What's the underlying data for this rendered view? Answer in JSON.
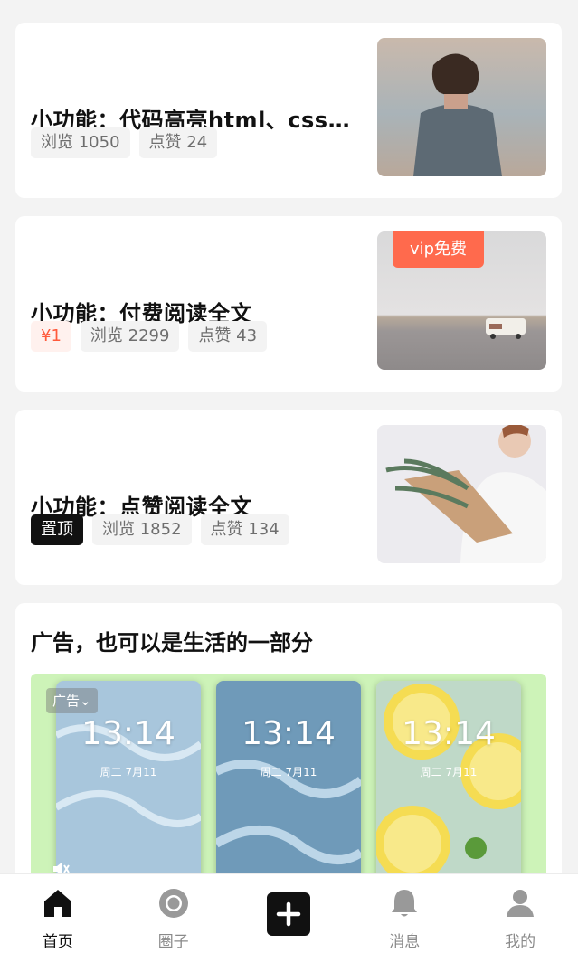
{
  "posts": [
    {
      "title": "小功能：代码高亮html、css...",
      "tags": [
        "浏览 1050",
        "点赞 24"
      ]
    },
    {
      "title": "小功能：付费阅读全文",
      "price": "¥1",
      "tags": [
        "浏览 2299",
        "点赞 43"
      ],
      "thumb_badge": "vip免费"
    },
    {
      "title": "小功能：点赞阅读全文",
      "pin": "置顶",
      "tags": [
        "浏览 1852",
        "点赞 134"
      ]
    }
  ],
  "ad": {
    "title": "广告，也可以是生活的一部分",
    "badge": "广告",
    "screens": [
      {
        "time": "13:14",
        "date": "周二 7月11"
      },
      {
        "time": "13:14",
        "date": "周二 7月11"
      },
      {
        "time": "13:14",
        "date": "周二 7月11"
      }
    ]
  },
  "tabbar": [
    {
      "label": "首页",
      "icon": "home-icon",
      "active": true
    },
    {
      "label": "圈子",
      "icon": "circle-icon",
      "active": false
    },
    {
      "label": "",
      "icon": "plus-icon",
      "active": false
    },
    {
      "label": "消息",
      "icon": "bell-icon",
      "active": false
    },
    {
      "label": "我的",
      "icon": "user-icon",
      "active": false
    }
  ],
  "colors": {
    "accent": "#ff6a4d",
    "price": "#ff5a3c",
    "ad_bg": "#cdf3b8",
    "dark": "#111111"
  }
}
